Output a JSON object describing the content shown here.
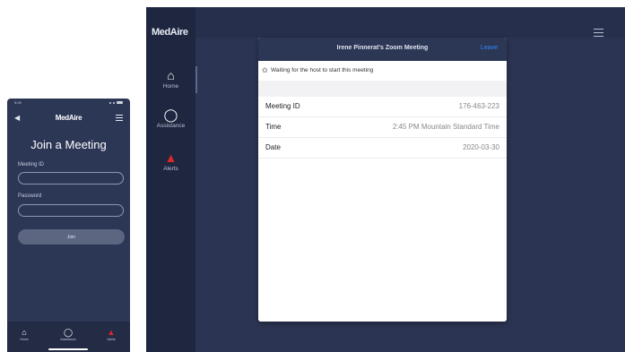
{
  "phone": {
    "status_time": "9:09",
    "brand": "MedAire",
    "title": "Join a Meeting",
    "meeting_id_label": "Meeting ID",
    "meeting_id_value": "",
    "password_label": "Password",
    "password_value": "",
    "join_label": "Join",
    "nav": [
      {
        "label": "Home",
        "icon": "home-icon"
      },
      {
        "label": "Assistance",
        "icon": "headset-icon"
      },
      {
        "label": "Alerts",
        "icon": "alert-icon"
      }
    ]
  },
  "tablet": {
    "brand": "MedAire",
    "nav": [
      {
        "label": "Home",
        "icon": "home-icon"
      },
      {
        "label": "Assistance",
        "icon": "headset-icon"
      },
      {
        "label": "Alerts",
        "icon": "alert-icon"
      }
    ],
    "modal": {
      "title": "Irene Pinnerat's Zoom Meeting",
      "leave_label": "Leave",
      "waiting_text": "Waiting for the host to start this meeting",
      "rows": [
        {
          "key": "Meeting ID",
          "value": "176-463-223"
        },
        {
          "key": "Time",
          "value": "2:45 PM Mountain Standard Time"
        },
        {
          "key": "Date",
          "value": "2020-03-30"
        }
      ]
    }
  },
  "colors": {
    "panel": "#2c3655",
    "sidebar": "#1e2640",
    "accent_link": "#2d8cff",
    "alert": "#e0262b"
  }
}
